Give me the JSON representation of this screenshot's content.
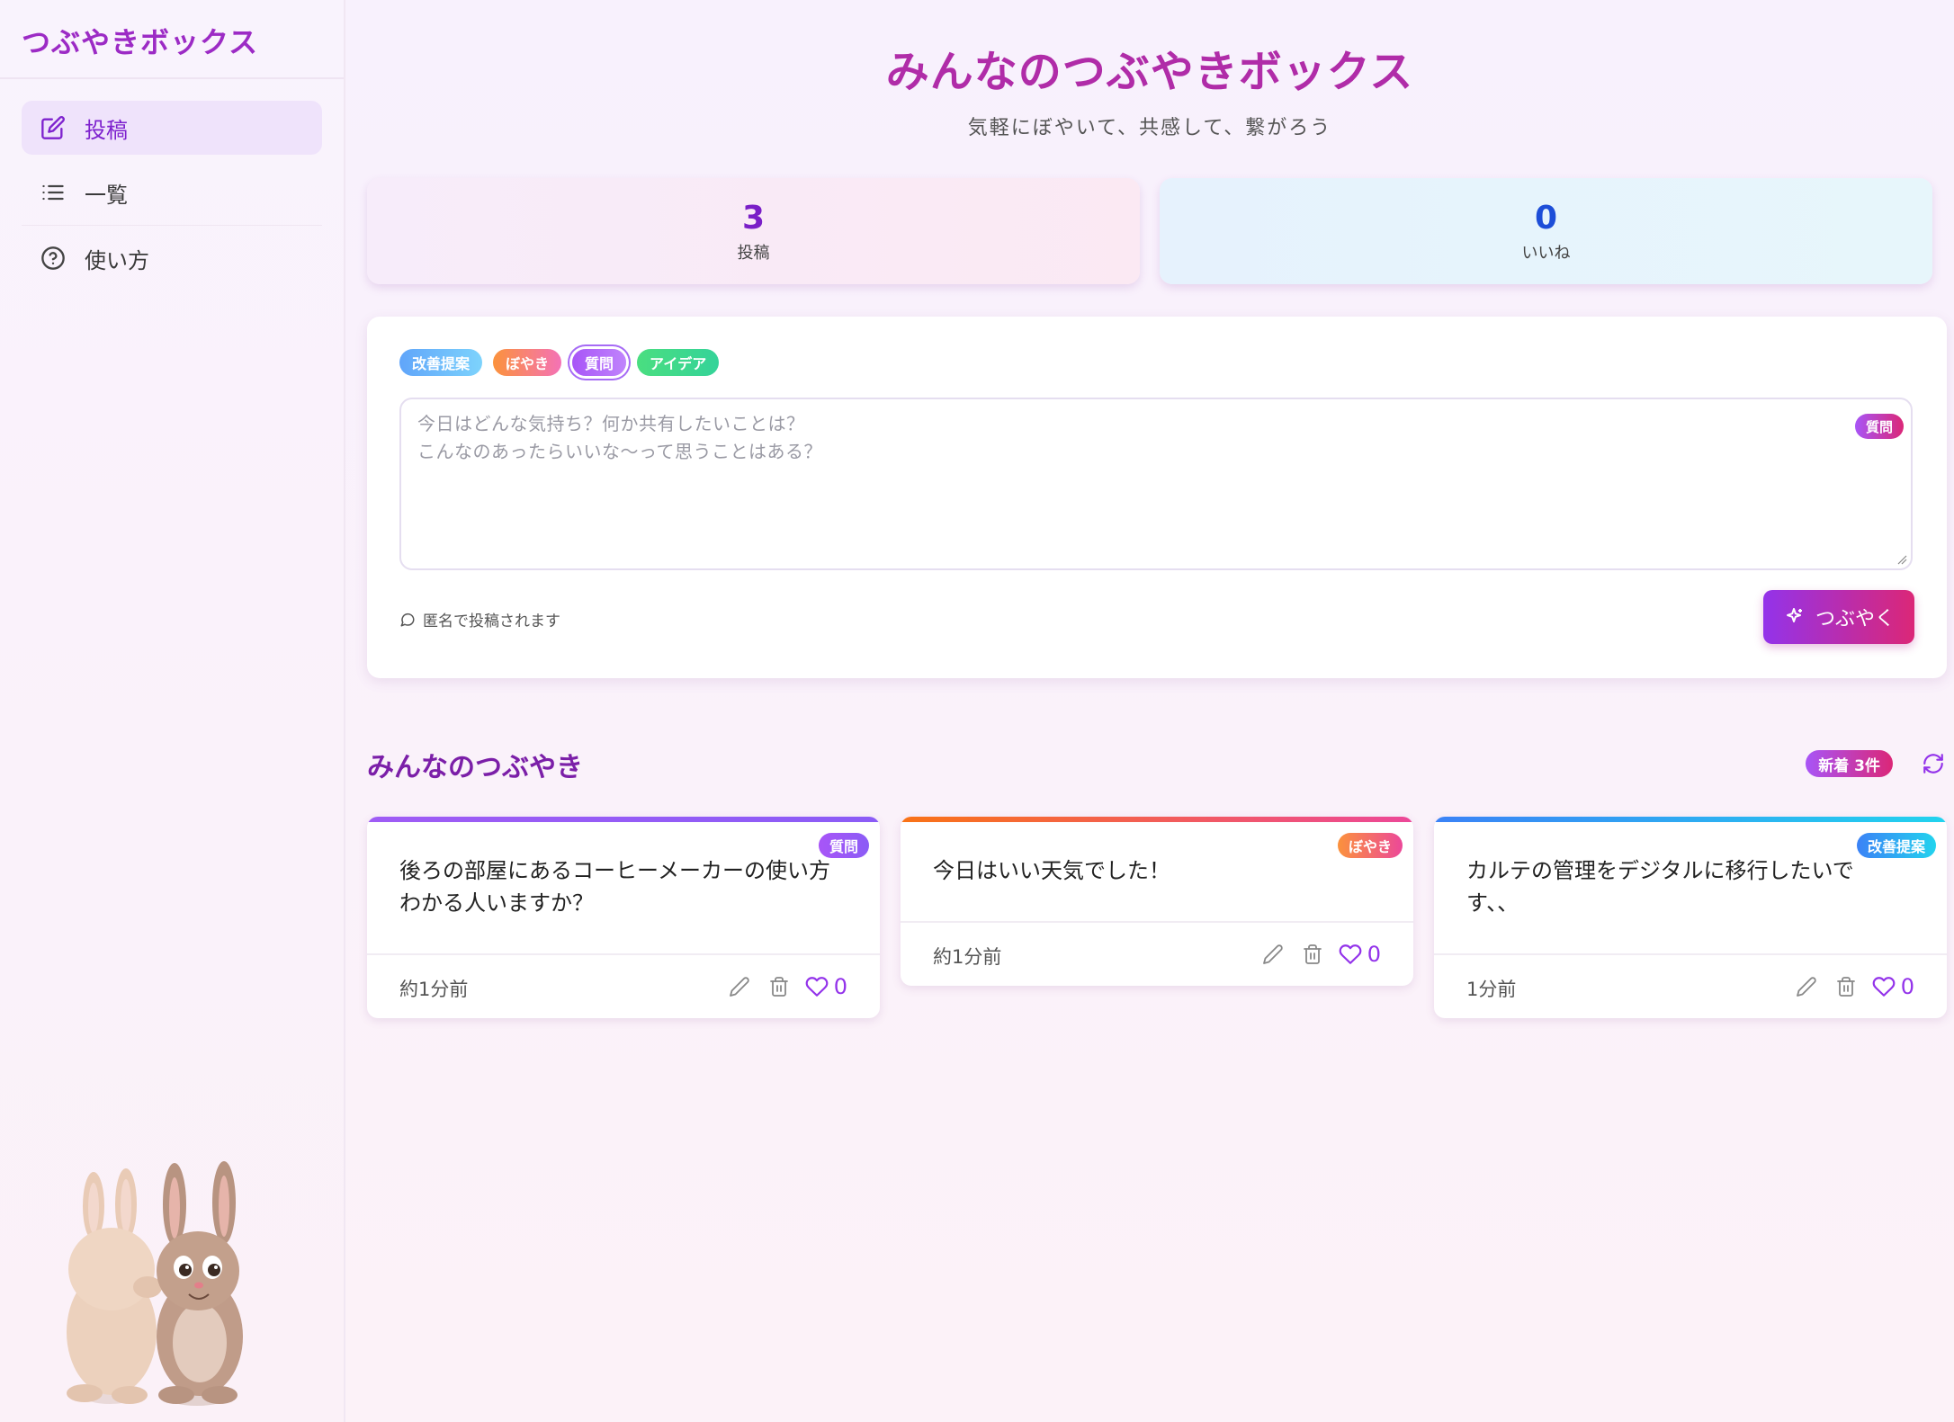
{
  "sidebar": {
    "brand": "つぶやきボックス",
    "items": [
      {
        "label": "投稿",
        "icon": "edit-icon",
        "active": true
      },
      {
        "label": "一覧",
        "icon": "list-icon",
        "active": false
      },
      {
        "label": "使い方",
        "icon": "help-circle-icon",
        "active": false
      }
    ]
  },
  "header": {
    "title": "みんなのつぶやきボックス",
    "subtitle": "気軽にぼやいて、共感して、繋がろう"
  },
  "stats": {
    "posts": {
      "value": "3",
      "label": "投稿"
    },
    "likes": {
      "value": "0",
      "label": "いいね"
    }
  },
  "composer": {
    "categories": [
      "改善提案",
      "ぼやき",
      "質問",
      "アイデア"
    ],
    "selected_category": "質問",
    "placeholder": "今日はどんな気持ち？何か共有したいことは？\nこんなのあったらいいな〜って思うことはある？",
    "badge": "質問",
    "anonymous_note": "匿名で投稿されます",
    "submit_label": "つぶやく"
  },
  "feed": {
    "title": "みんなのつぶやき",
    "new_badge": "新着 3件",
    "posts": [
      {
        "category": "質問",
        "text": "後ろの部屋にあるコーヒーメーカーの使い方わかる人いますか？",
        "time": "約1分前",
        "likes": "0",
        "color": "#9f5cf5"
      },
      {
        "category": "ぼやき",
        "text": "今日はいい天気でした！",
        "time": "約1分前",
        "likes": "0",
        "color": "#f8733a"
      },
      {
        "category": "改善提案",
        "text": "カルテの管理をデジタルに移行したいです、、",
        "time": "1分前",
        "likes": "0",
        "color": "#3b82f6"
      }
    ]
  },
  "colors": {
    "accent": "#9333ea",
    "brand": "#b02ca8",
    "like": "#9333ea"
  }
}
